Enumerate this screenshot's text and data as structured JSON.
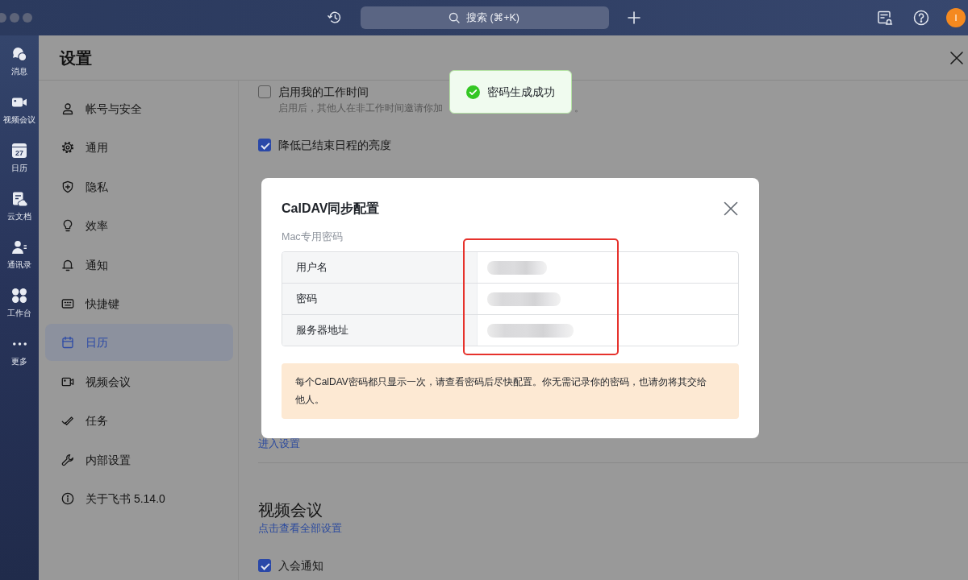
{
  "title_bar": {
    "search": {
      "placeholder": "搜索 (⌘+K)"
    },
    "avatar": {
      "initial": "I"
    }
  },
  "rail": {
    "items": [
      {
        "label": "消息",
        "selected": false
      },
      {
        "label": "视频会议",
        "selected": false
      },
      {
        "label": "日历",
        "icon_text": "27",
        "selected": false
      },
      {
        "label": "云文档",
        "selected": false
      },
      {
        "label": "通讯录",
        "selected": false
      },
      {
        "label": "工作台",
        "selected": false
      },
      {
        "label": "更多",
        "selected": false
      }
    ]
  },
  "settings": {
    "title": "设置",
    "nav": [
      {
        "label": "帐号与安全",
        "selected": false
      },
      {
        "label": "通用",
        "selected": false
      },
      {
        "label": "隐私",
        "selected": false
      },
      {
        "label": "效率",
        "selected": false
      },
      {
        "label": "通知",
        "selected": false
      },
      {
        "label": "快捷键",
        "selected": false
      },
      {
        "label": "日历",
        "selected": true
      },
      {
        "label": "视频会议",
        "selected": false
      },
      {
        "label": "任务",
        "selected": false
      },
      {
        "label": "内部设置",
        "selected": false
      },
      {
        "label": "关于飞书 5.14.0",
        "selected": false
      }
    ],
    "content": {
      "rows": [
        {
          "label": "启用我的工作时间",
          "checked": false,
          "description_parts": [
            "启用后，其他人在非工作时间邀请你加",
            "。"
          ]
        },
        {
          "label": "降低已结束日程的亮度",
          "checked": true
        }
      ],
      "link": "进入设置",
      "sections": [
        {
          "title": "视频会议",
          "link": "点击查看全部设置",
          "rows": [
            {
              "label": "入会通知",
              "checked": true
            }
          ]
        }
      ]
    }
  },
  "toast": {
    "text": "密码生成成功"
  },
  "dialog": {
    "title": "CalDAV同步配置",
    "subtitle": "Mac专用密码",
    "fields": [
      {
        "label": "用户名",
        "redacted": true
      },
      {
        "label": "密码",
        "redacted": true
      },
      {
        "label": "服务器地址",
        "redacted": true
      }
    ],
    "notice": "每个CalDAV密码都只显示一次，请查看密码后尽快配置。你无需记录你的密码，也请勿将其交给他人。"
  }
}
